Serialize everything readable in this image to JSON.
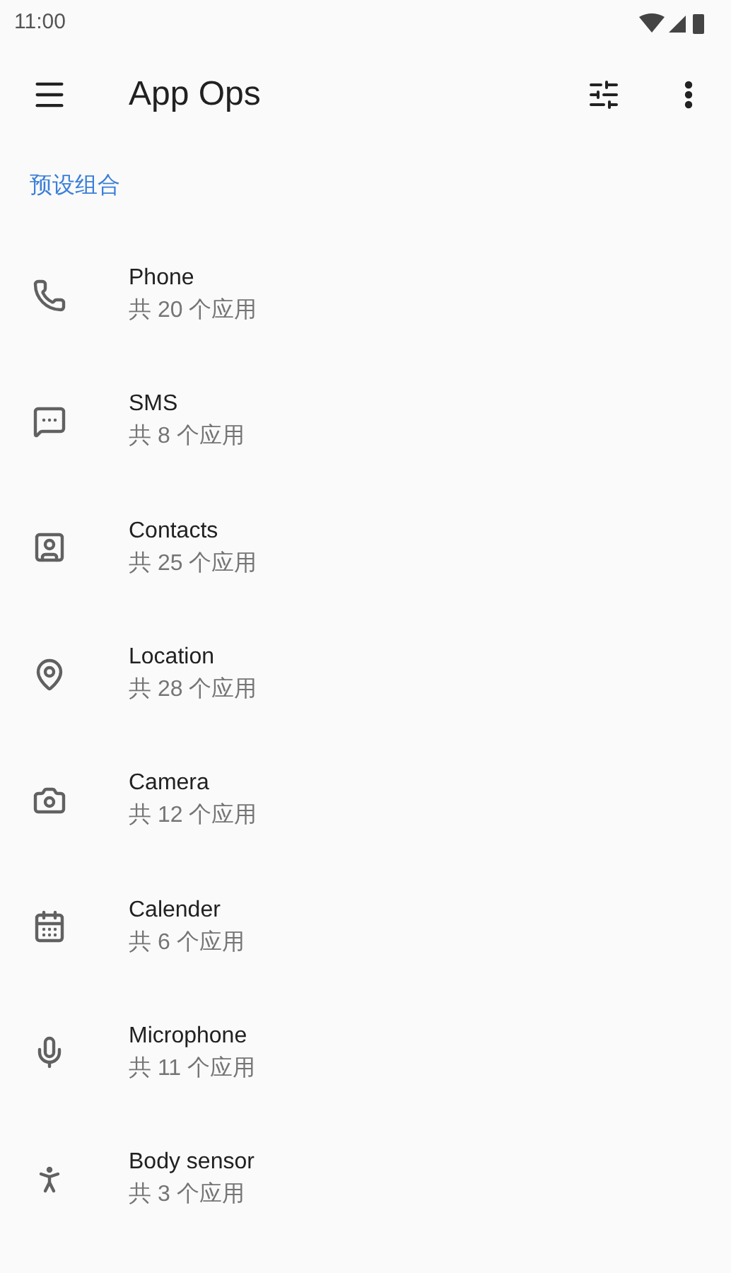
{
  "status_bar": {
    "time": "11:00"
  },
  "toolbar": {
    "title": "App Ops"
  },
  "section": {
    "title": "预设组合"
  },
  "items": [
    {
      "kind": "phone",
      "title": "Phone",
      "subtitle": "共 20 个应用"
    },
    {
      "kind": "sms",
      "title": "SMS",
      "subtitle": "共 8 个应用"
    },
    {
      "kind": "contacts",
      "title": "Contacts",
      "subtitle": "共 25 个应用"
    },
    {
      "kind": "location",
      "title": "Location",
      "subtitle": "共 28 个应用"
    },
    {
      "kind": "camera",
      "title": "Camera",
      "subtitle": "共 12 个应用"
    },
    {
      "kind": "calendar",
      "title": "Calender",
      "subtitle": "共 6 个应用"
    },
    {
      "kind": "microphone",
      "title": "Microphone",
      "subtitle": "共 11 个应用"
    },
    {
      "kind": "sensor",
      "title": "Body sensor",
      "subtitle": "共 3 个应用"
    }
  ]
}
